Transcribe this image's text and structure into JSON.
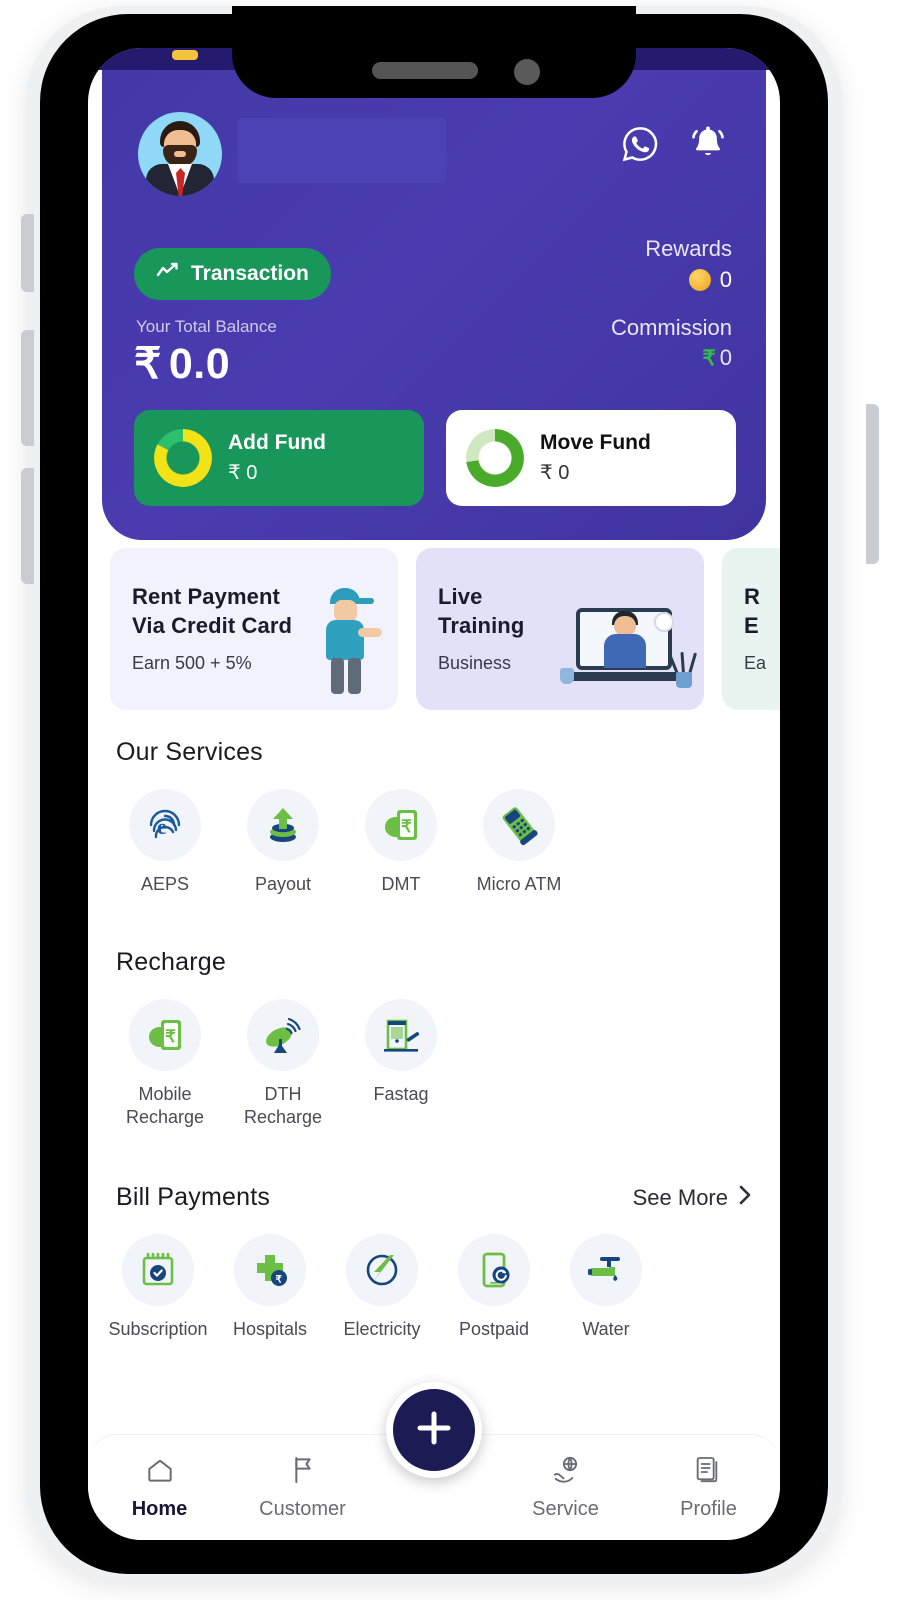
{
  "app": {
    "accent_purple": "#4438a8",
    "accent_green": "#199659",
    "accent_navy": "#1d1b54",
    "icon_green": "#6cbe45",
    "icon_blue": "#1b5a9e"
  },
  "header": {
    "avatar": "user-avatar",
    "name_masked": "",
    "whatsapp_icon": "whatsapp-icon",
    "bell_icon": "notification-bell-icon",
    "transaction_button": "Transaction",
    "transaction_icon": "trend-line-icon",
    "balance_label": "Your Total Balance",
    "balance_currency": "₹",
    "balance_amount": "0.0",
    "rewards_label": "Rewards",
    "rewards_value": "0",
    "rewards_icon": "coin-icon",
    "commission_label": "Commission",
    "commission_currency": "₹",
    "commission_value": "0",
    "add_fund": {
      "title": "Add Fund",
      "amount": "₹ 0",
      "icon": "donut-chart-icon"
    },
    "move_fund": {
      "title": "Move Fund",
      "amount": "₹ 0",
      "icon": "donut-chart-icon"
    }
  },
  "promos": [
    {
      "title": "Rent Payment\nVia Credit Card",
      "title_line1": "Rent Payment",
      "title_line2": "Via Credit Card",
      "sub": "Earn 500 + 5%",
      "bg": "#f1f2fb",
      "art": "delivery-person-illustration"
    },
    {
      "title_line1": "Live",
      "title_line2": "Training",
      "sub": "Business",
      "bg": "#e3e1f7",
      "art": "laptop-training-illustration"
    },
    {
      "title_line1": "R",
      "title_line2": "E",
      "sub": "Ea",
      "bg": "#e8f4ef",
      "art": ""
    }
  ],
  "services": {
    "heading": "Our Services",
    "items": [
      {
        "label": "AEPS",
        "icon": "aeps-fingerprint-icon"
      },
      {
        "label": "Payout",
        "icon": "payout-upload-icon"
      },
      {
        "label": "DMT",
        "icon": "dmt-money-transfer-icon"
      },
      {
        "label": "Micro ATM",
        "icon": "micro-atm-pos-icon"
      }
    ]
  },
  "recharge": {
    "heading": "Recharge",
    "items": [
      {
        "label": "Mobile\nRecharge",
        "icon": "mobile-recharge-icon"
      },
      {
        "label": "DTH\nRecharge",
        "icon": "dth-dish-icon"
      },
      {
        "label": "Fastag",
        "icon": "fastag-toll-icon"
      }
    ]
  },
  "bills": {
    "heading": "Bill Payments",
    "see_more": "See More",
    "see_more_icon": "chevron-right-icon",
    "items": [
      {
        "label": "Subscription",
        "icon": "subscription-calendar-icon"
      },
      {
        "label": "Hospitals",
        "icon": "hospital-cross-icon"
      },
      {
        "label": "Electricity",
        "icon": "electricity-bolt-icon"
      },
      {
        "label": "Postpaid",
        "icon": "postpaid-phone-icon"
      },
      {
        "label": "Water",
        "icon": "water-tap-icon"
      }
    ]
  },
  "bottom_nav": {
    "fab_icon": "plus-icon",
    "items": [
      {
        "label": "Home",
        "icon": "home-icon",
        "active": true
      },
      {
        "label": "Customer",
        "icon": "flag-icon",
        "active": false
      },
      {
        "label": "Service",
        "icon": "globe-hand-icon",
        "active": false
      },
      {
        "label": "Profile",
        "icon": "documents-icon",
        "active": false
      }
    ]
  }
}
